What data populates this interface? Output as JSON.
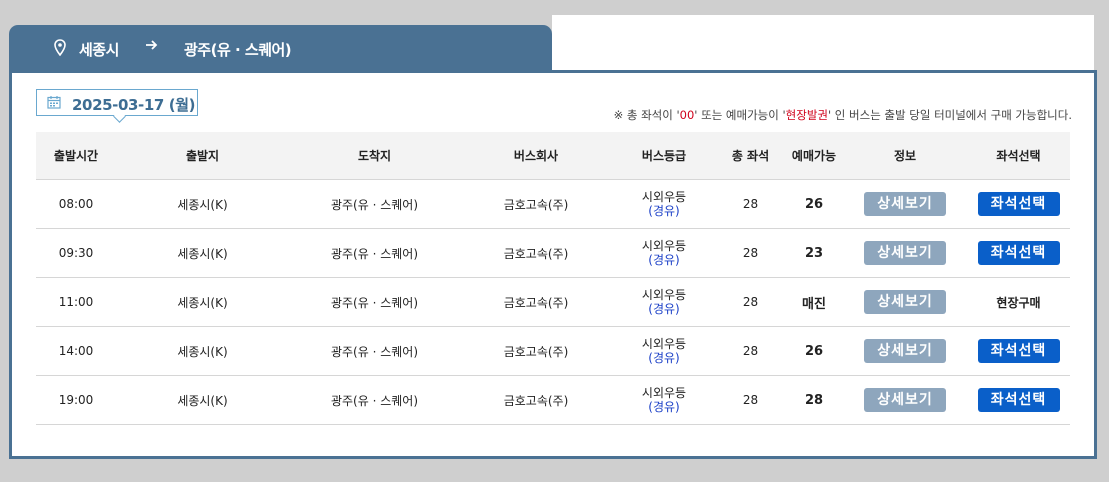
{
  "route": {
    "from": "세종시",
    "to": "광주(유 · 스퀘어)"
  },
  "date": "2025-03-17 (월)",
  "notice": {
    "prefix": "※ 총 좌석이 '",
    "zero": "00",
    "middle": "' 또는 예매가능이 '",
    "onsite": "현장발권",
    "suffix": "' 인 버스는 출발 당일 터미널에서 구매 가능합니다."
  },
  "headers": [
    "출발시간",
    "출발지",
    "도착지",
    "버스회사",
    "버스등급",
    "총 좌석",
    "예매가능",
    "정보",
    "좌석선택"
  ],
  "rows": [
    {
      "time": "08:00",
      "origin": "세종시(K)",
      "dest": "광주(유 · 스퀘어)",
      "company": "금호고속(주)",
      "grade": "시외우등",
      "via": "(경유)",
      "seats": "28",
      "available": "26",
      "detail": "상세보기",
      "select": "좌석선택",
      "select_type": "button"
    },
    {
      "time": "09:30",
      "origin": "세종시(K)",
      "dest": "광주(유 · 스퀘어)",
      "company": "금호고속(주)",
      "grade": "시외우등",
      "via": "(경유)",
      "seats": "28",
      "available": "23",
      "detail": "상세보기",
      "select": "좌석선택",
      "select_type": "button"
    },
    {
      "time": "11:00",
      "origin": "세종시(K)",
      "dest": "광주(유 · 스퀘어)",
      "company": "금호고속(주)",
      "grade": "시외우등",
      "via": "(경유)",
      "seats": "28",
      "available": "매진",
      "detail": "상세보기",
      "select": "현장구매",
      "select_type": "text"
    },
    {
      "time": "14:00",
      "origin": "세종시(K)",
      "dest": "광주(유 · 스퀘어)",
      "company": "금호고속(주)",
      "grade": "시외우등",
      "via": "(경유)",
      "seats": "28",
      "available": "26",
      "detail": "상세보기",
      "select": "좌석선택",
      "select_type": "button"
    },
    {
      "time": "19:00",
      "origin": "세종시(K)",
      "dest": "광주(유 · 스퀘어)",
      "company": "금호고속(주)",
      "grade": "시외우등",
      "via": "(경유)",
      "seats": "28",
      "available": "28",
      "detail": "상세보기",
      "select": "좌석선택",
      "select_type": "button"
    }
  ],
  "colors": {
    "header_blue": "#4a7193",
    "select_button": "#0a5fc9",
    "detail_button": "#8ea6bd",
    "notice_red": "#d0021b",
    "via_blue": "#1a3fc7"
  }
}
